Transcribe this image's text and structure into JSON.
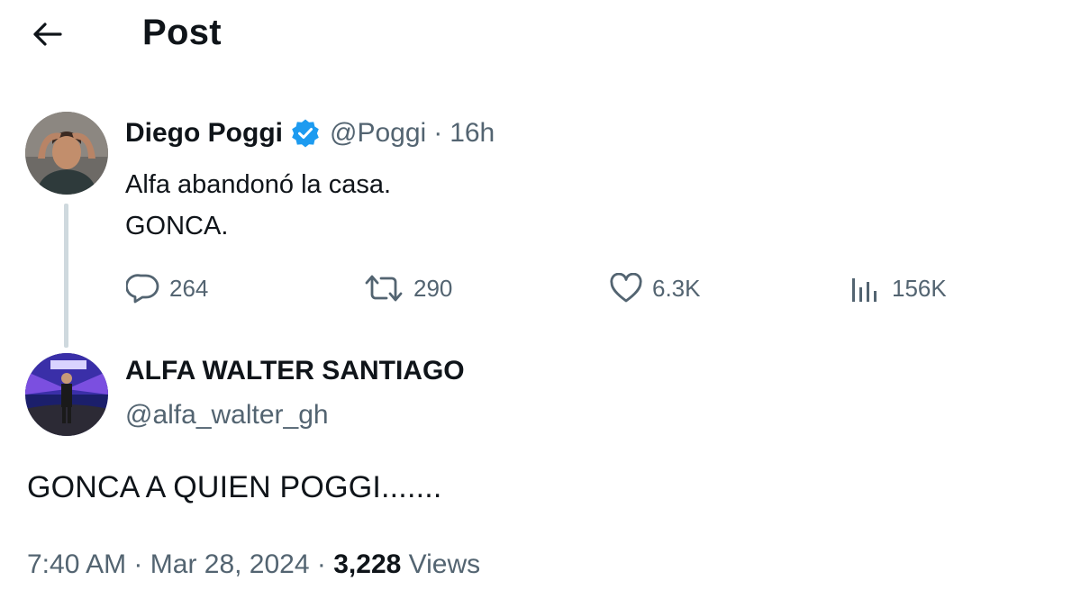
{
  "header": {
    "title": "Post",
    "back_icon": "arrow-left-icon"
  },
  "tweet1": {
    "name": "Diego Poggi",
    "verified_icon": "verified-badge-icon",
    "verified_color": "#1d9bf0",
    "handle": "@Poggi",
    "separator": "·",
    "time": "16h",
    "text_lines": [
      "Alfa abandonó la casa.",
      "GONCA."
    ],
    "actions": {
      "replies": "264",
      "reposts": "290",
      "likes": "6.3K",
      "views": "156K"
    }
  },
  "tweet2": {
    "name": "ALFA WALTER SANTIAGO",
    "handle": "@alfa_walter_gh",
    "text": "GONCA A QUIEN POGGI.......",
    "meta": {
      "time": "7:40 AM",
      "sep1": "·",
      "date": "Mar 28, 2024",
      "sep2": "·",
      "views_count": "3,228",
      "views_label": "Views"
    }
  },
  "colors": {
    "text_primary": "#0f1419",
    "text_secondary": "#536471",
    "thread_line": "#cfd9de",
    "accent": "#1d9bf0"
  }
}
